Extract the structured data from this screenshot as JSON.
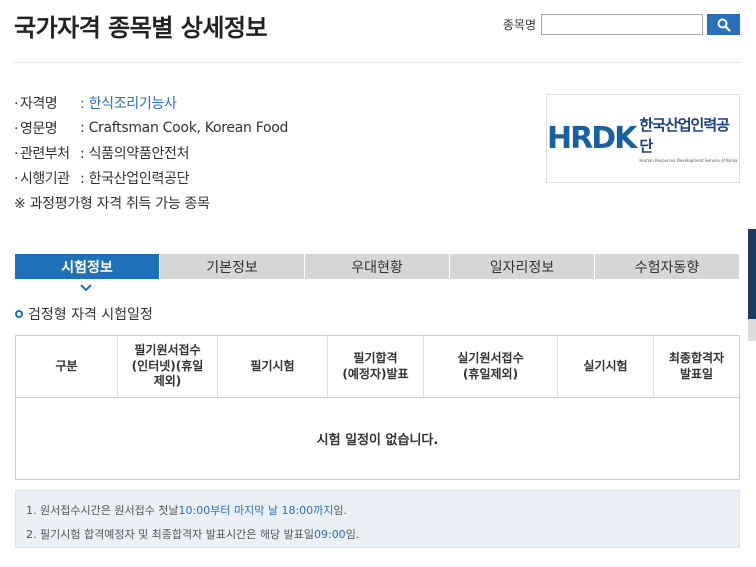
{
  "page": {
    "title": "국가자격 종목별 상세정보"
  },
  "search": {
    "label": "종목명",
    "value": "",
    "placeholder": ""
  },
  "info": {
    "rows": [
      {
        "label": "자격명",
        "value": ": 한식조리기능사"
      },
      {
        "label": "영문명",
        "value": ": Craftsman Cook, Korean Food"
      },
      {
        "label": "관련부처",
        "value": ": 식품의약품안전처"
      },
      {
        "label": "시행기관",
        "value": ": 한국산업인력공단"
      }
    ],
    "note": "※ 과정평가형 자격 취득 가능 종목"
  },
  "logo": {
    "mark": "HRDK",
    "korean": "한국산업인력공단",
    "english": "Human Resources Development Service of Korea"
  },
  "tabs": [
    "시험정보",
    "기본정보",
    "우대현황",
    "일자리정보",
    "수험자동향"
  ],
  "section": {
    "title": "검정형 자격 시험일정"
  },
  "table": {
    "headers": [
      "구분",
      "필기원서접수\n(인터넷)(휴일\n제외)",
      "필기시험",
      "필기합격\n(예정자)발표",
      "실기원서접수\n(휴일제외)",
      "실기시험",
      "최종합격자\n발표일"
    ],
    "empty_message": "시험 일정이 없습니다."
  },
  "notes": {
    "line1": {
      "prefix": "1. 원서접수시간은 원서접수 첫날 ",
      "highlight": "10:00부터 마지막 날 18:00까지",
      "suffix": " 임."
    },
    "line2": {
      "prefix": "2. 필기시험 합격예정자 및 최종합격자 발표시간은 해당 발표일 ",
      "highlight": "09:00",
      "suffix": "임."
    }
  },
  "colors": {
    "accent": "#1e70b8",
    "link": "#2a6fb8",
    "tab_inactive": "#d6d6d6",
    "notes_bg": "#eaf0f6"
  }
}
